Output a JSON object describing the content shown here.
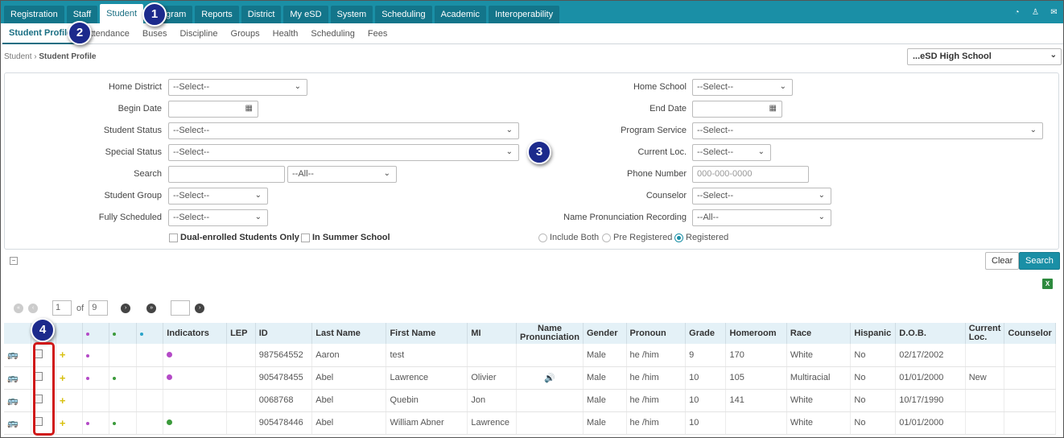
{
  "topnav": {
    "tabs": [
      "Registration",
      "Staff",
      "Student",
      "Program",
      "Reports",
      "District",
      "My eSD",
      "System",
      "Scheduling",
      "Academic",
      "Interoperability"
    ],
    "active": "Student"
  },
  "subnav": {
    "tabs": [
      "Student Profile",
      "Attendance",
      "Buses",
      "Discipline",
      "Groups",
      "Health",
      "Scheduling",
      "Fees"
    ],
    "active": "Student Profile"
  },
  "breadcrumb": {
    "root": "Student",
    "current": "Student Profile"
  },
  "school": "...eSD High School",
  "filters": {
    "home_district": {
      "label": "Home District",
      "value": "--Select--"
    },
    "begin_date": {
      "label": "Begin Date",
      "value": ""
    },
    "student_status": {
      "label": "Student Status",
      "value": "--Select--"
    },
    "special_status": {
      "label": "Special Status",
      "value": "--Select--"
    },
    "search": {
      "label": "Search",
      "value": "",
      "scope": "--All--"
    },
    "student_group": {
      "label": "Student Group",
      "value": "--Select--"
    },
    "fully_scheduled": {
      "label": "Fully Scheduled",
      "value": "--Select--"
    },
    "home_school": {
      "label": "Home School",
      "value": "--Select--"
    },
    "end_date": {
      "label": "End Date",
      "value": ""
    },
    "program_service": {
      "label": "Program Service",
      "value": "--Select--"
    },
    "current_loc": {
      "label": "Current Loc.",
      "value": "--Select--"
    },
    "phone_number": {
      "label": "Phone Number",
      "placeholder": "000-000-0000"
    },
    "counselor": {
      "label": "Counselor",
      "value": "--Select--"
    },
    "name_pron": {
      "label": "Name Pronunciation Recording",
      "value": "--All--"
    },
    "dual_enrolled": "Dual-enrolled Students Only",
    "summer_school": "In Summer School",
    "radio": {
      "include_both": "Include Both",
      "pre_registered": "Pre Registered",
      "registered": "Registered"
    }
  },
  "buttons": {
    "clear": "Clear",
    "search": "Search"
  },
  "pager": {
    "page": "1",
    "of": "of",
    "total": "9"
  },
  "table": {
    "headers": [
      "Indicators",
      "LEP",
      "ID",
      "Last Name",
      "First Name",
      "MI",
      "Name Pronunciation",
      "Gender",
      "Pronoun",
      "Grade",
      "Homeroom",
      "Race",
      "Hispanic",
      "D.O.B.",
      "Current Loc.",
      "Counselor"
    ],
    "rows": [
      {
        "id": "987564552",
        "last": "Aaron",
        "first": "test",
        "mi": "",
        "gender": "Male",
        "pronoun": "he /him",
        "grade": "9",
        "homeroom": "170",
        "race": "White",
        "hispanic": "No",
        "dob": "02/17/2002",
        "loc": ""
      },
      {
        "id": "905478455",
        "last": "Abel",
        "first": "Lawrence",
        "mi": "Olivier",
        "gender": "Male",
        "pronoun": "he /him",
        "grade": "10",
        "homeroom": "105",
        "race": "Multiracial",
        "hispanic": "No",
        "dob": "01/01/2000",
        "loc": "New"
      },
      {
        "id": "0068768",
        "last": "Abel",
        "first": "Quebin",
        "mi": "Jon",
        "gender": "Male",
        "pronoun": "he /him",
        "grade": "10",
        "homeroom": "141",
        "race": "White",
        "hispanic": "No",
        "dob": "10/17/1990",
        "loc": ""
      },
      {
        "id": "905478446",
        "last": "Abel",
        "first": "William Abner",
        "mi": "Lawrence",
        "gender": "Male",
        "pronoun": "he /him",
        "grade": "10",
        "homeroom": "",
        "race": "White",
        "hispanic": "No",
        "dob": "01/01/2000",
        "loc": ""
      }
    ]
  },
  "callouts": [
    "1",
    "2",
    "3",
    "4"
  ],
  "colors": {
    "brand": "#1a8fa6",
    "callout": "#1c2a8c",
    "highlight": "#d01818"
  }
}
